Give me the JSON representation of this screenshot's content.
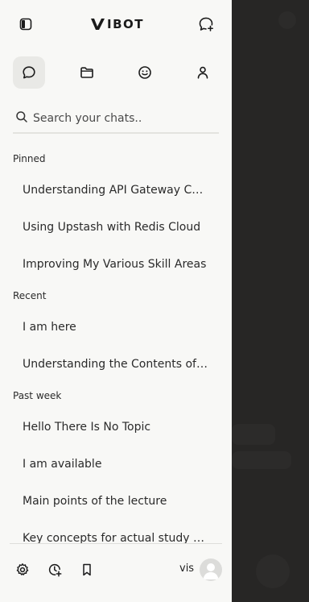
{
  "header": {
    "brand": "VIBOT",
    "brand_tail": "IBOT",
    "toggle_icon": "sidebar-toggle-icon",
    "new_chat_icon": "new-chat-icon"
  },
  "nav_tabs": [
    {
      "name": "chats",
      "icon": "chat-bubble-icon",
      "active": true
    },
    {
      "name": "folders",
      "icon": "folder-icon",
      "active": false
    },
    {
      "name": "emoji",
      "icon": "smiley-icon",
      "active": false
    },
    {
      "name": "profile",
      "icon": "user-icon",
      "active": false
    }
  ],
  "search": {
    "placeholder": "Search your chats.."
  },
  "sections": {
    "pinned": "Pinned",
    "recent": "Recent",
    "past_week": "Past week"
  },
  "chats": {
    "pinned": [
      "Understanding API Gateway Configuration",
      "Using Upstash with Redis Cloud",
      "Improving My Various Skill Areas"
    ],
    "recent": [
      "I am here",
      "Understanding the Contents of Documents"
    ],
    "past_week": [
      "Hello There Is No Topic",
      "I am available",
      "Main points of the lecture",
      "Key concepts for actual study plan"
    ]
  },
  "footer": {
    "username": "vis",
    "icons": [
      "settings-icon",
      "history-icon",
      "bookmark-icon"
    ]
  },
  "colors": {
    "sidebar_bg": "#f8f8f6",
    "overlay_bg": "#272625",
    "active_tab_bg": "#e9e9e6",
    "text": "#2a2a2a"
  }
}
